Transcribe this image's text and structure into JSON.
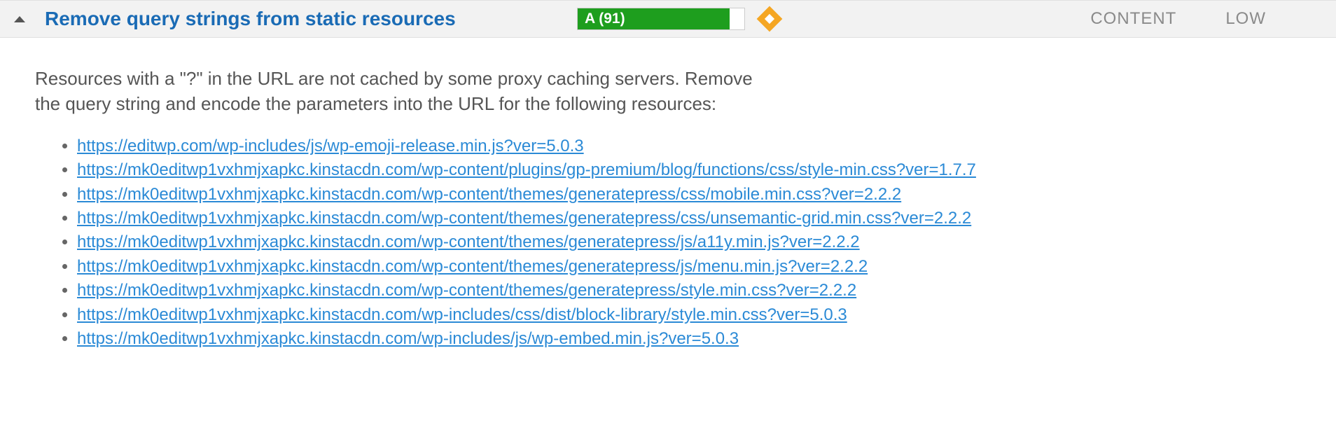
{
  "rule": {
    "title": "Remove query strings from static resources",
    "grade_label": "A (91)",
    "grade_percent": 91,
    "category": "CONTENT",
    "priority": "LOW"
  },
  "description": "Resources with a \"?\" in the URL are not cached by some proxy caching servers. Remove the query string and encode the parameters into the URL for the following resources:",
  "resources": [
    "https://editwp.com/wp-includes/js/wp-emoji-release.min.js?ver=5.0.3",
    "https://mk0editwp1vxhmjxapkc.kinstacdn.com/wp-content/plugins/gp-premium/blog/functions/css/style-min.css?ver=1.7.7",
    "https://mk0editwp1vxhmjxapkc.kinstacdn.com/wp-content/themes/generatepress/css/mobile.min.css?ver=2.2.2",
    "https://mk0editwp1vxhmjxapkc.kinstacdn.com/wp-content/themes/generatepress/css/unsemantic-grid.min.css?ver=2.2.2",
    "https://mk0editwp1vxhmjxapkc.kinstacdn.com/wp-content/themes/generatepress/js/a11y.min.js?ver=2.2.2",
    "https://mk0editwp1vxhmjxapkc.kinstacdn.com/wp-content/themes/generatepress/js/menu.min.js?ver=2.2.2",
    "https://mk0editwp1vxhmjxapkc.kinstacdn.com/wp-content/themes/generatepress/style.min.css?ver=2.2.2",
    "https://mk0editwp1vxhmjxapkc.kinstacdn.com/wp-includes/css/dist/block-library/style.min.css?ver=5.0.3",
    "https://mk0editwp1vxhmjxapkc.kinstacdn.com/wp-includes/js/wp-embed.min.js?ver=5.0.3"
  ]
}
